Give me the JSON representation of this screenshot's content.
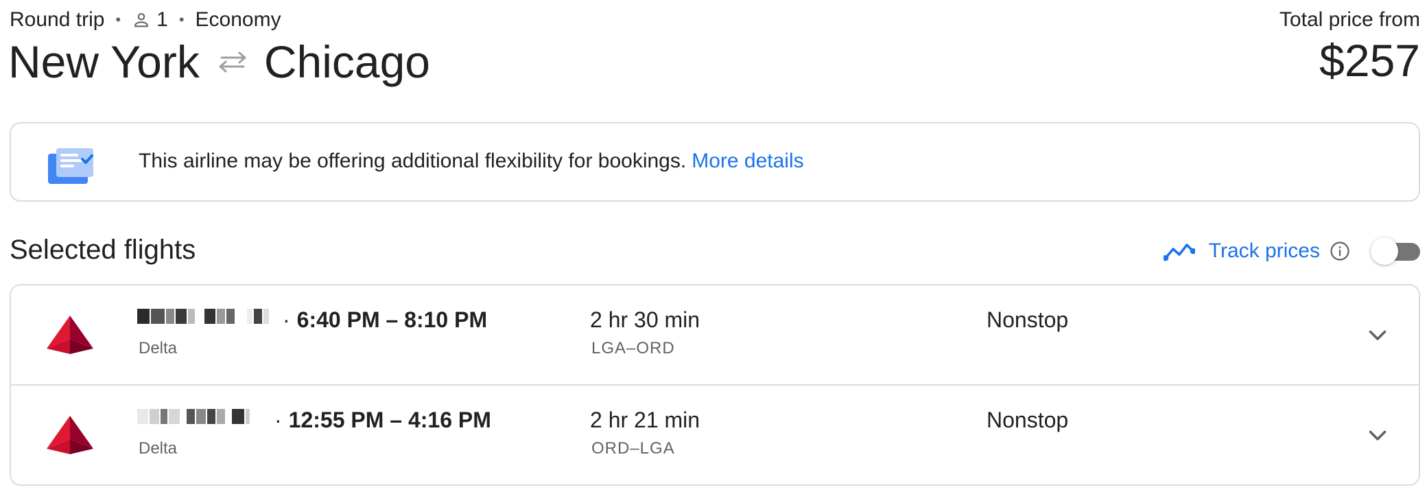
{
  "summary": {
    "trip_type": "Round trip",
    "passengers": "1",
    "cabin": "Economy",
    "origin": "New York",
    "destination": "Chicago"
  },
  "price": {
    "label": "Total price from",
    "value": "$257"
  },
  "notice": {
    "text": "This airline may be offering additional flexibility for bookings.",
    "link": "More details"
  },
  "section": {
    "title": "Selected flights"
  },
  "track": {
    "label": "Track prices",
    "enabled": false
  },
  "flights": [
    {
      "times": "6:40 PM – 8:10 PM",
      "airline": "Delta",
      "duration": "2 hr 30 min",
      "airports": "LGA–ORD",
      "stops": "Nonstop"
    },
    {
      "times": "12:55 PM – 4:16 PM",
      "airline": "Delta",
      "duration": "2 hr 21 min",
      "airports": "ORD–LGA",
      "stops": "Nonstop"
    }
  ],
  "icons": {
    "person": "person-icon",
    "swap": "swap-arrows-icon",
    "notice": "flexible-booking-icon",
    "trend": "trend-line-icon",
    "info": "info-icon",
    "airline_logo": "delta-logo",
    "expand": "chevron-down-icon"
  },
  "colors": {
    "link": "#1a73e8",
    "text": "#202124",
    "secondary": "#5f6368",
    "border": "#dadce0",
    "delta_red": "#e01933"
  }
}
